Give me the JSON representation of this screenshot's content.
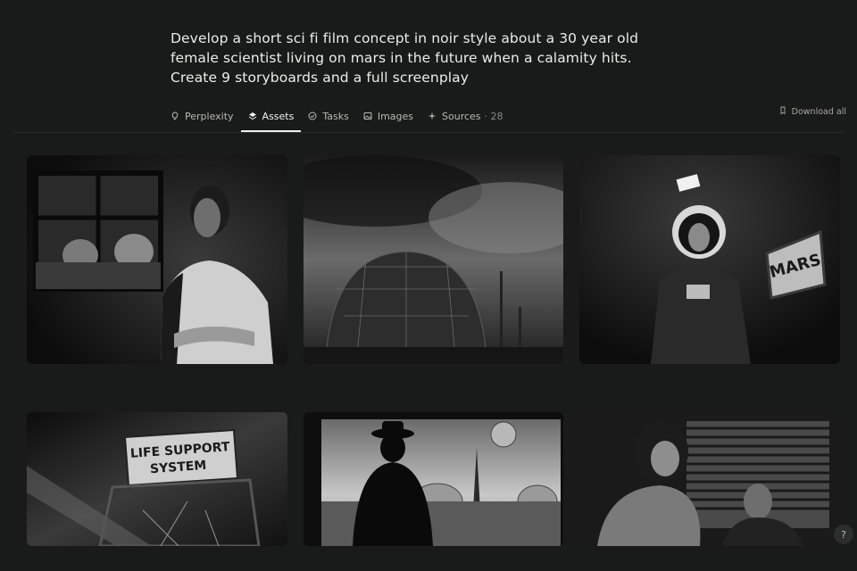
{
  "prompt": {
    "line1": "Develop a short sci fi film concept in noir style about a 30 year old",
    "line2": "female scientist living on mars in the future when a calamity hits.",
    "line3": "Create 9 storyboards and a full screenplay"
  },
  "tabs": [
    {
      "label": "Perplexity",
      "icon": "lightbulb-icon",
      "active": false
    },
    {
      "label": "Assets",
      "icon": "layers-icon",
      "active": true
    },
    {
      "label": "Tasks",
      "icon": "check-circle-icon",
      "active": false
    },
    {
      "label": "Images",
      "icon": "image-icon",
      "active": false
    },
    {
      "label": "Sources",
      "icon": "sparkle-icon",
      "active": false,
      "count": "· 28"
    }
  ],
  "download": {
    "label": "Download all",
    "icon": "download-icon"
  },
  "images": {
    "img4_sign_line1": "LIFE SUPPORT",
    "img4_sign_line2": "SYSTEM",
    "img3_sign": "MARS"
  },
  "help": {
    "label": "?"
  }
}
